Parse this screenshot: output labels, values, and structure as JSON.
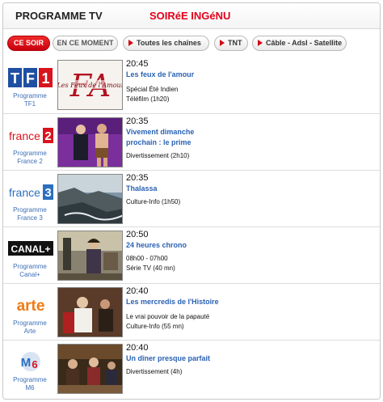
{
  "header": {
    "title": "PROGRAMME TV",
    "subtitle": "SOIRéE INGéNU"
  },
  "tabs": [
    {
      "label": "CE SOIR",
      "active": true
    },
    {
      "label": "EN CE MOMENT",
      "active": false
    },
    {
      "label": "Toutes les chaînes",
      "active": false
    },
    {
      "label": "TNT",
      "active": false
    },
    {
      "label": "Câble - Adsl - Satellite",
      "active": false
    }
  ],
  "programs": [
    {
      "channel_logo": "TF1",
      "channel_label": [
        "Programme",
        "TF1"
      ],
      "thumb_text": "Les Feux de l'Amour",
      "time": "20:45",
      "title": [
        "Les feux de l'amour"
      ],
      "desc": [
        "Spécial Été Indien",
        "Téléfilm (1h20)"
      ]
    },
    {
      "channel_logo": "france 2",
      "channel_label": [
        "Programme",
        "France 2"
      ],
      "time": "20:35",
      "title": [
        "Vivement dimanche",
        "prochain : le prime"
      ],
      "desc": [
        "Divertissement (2h10)"
      ]
    },
    {
      "channel_logo": "france 3",
      "channel_label": [
        "Programme",
        "France 3"
      ],
      "time": "20:35",
      "title": [
        "Thalassa"
      ],
      "desc": [
        "Culture-Info (1h50)"
      ]
    },
    {
      "channel_logo": "CANAL+",
      "channel_label": [
        "Programme",
        "Canal+"
      ],
      "time": "20:50",
      "title": [
        "24 heures chrono"
      ],
      "desc": [
        "08h00 - 07h00",
        "Série TV (40 mn)"
      ]
    },
    {
      "channel_logo": "arte",
      "channel_label": [
        "Programme",
        "Arte"
      ],
      "time": "20:40",
      "title": [
        "Les mercredis de l'Histoire"
      ],
      "desc": [
        "Le vrai pouvoir de la papauté",
        "Culture-Info (55 mn)"
      ]
    },
    {
      "channel_logo": "M6",
      "channel_label": [
        "Programme",
        "M6"
      ],
      "time": "20:40",
      "title": [
        "Un dîner presque parfait"
      ],
      "desc": [
        "Divertissement (4h)"
      ]
    }
  ],
  "colors": {
    "accent_red": "#e2001a",
    "link_blue": "#2a62b3",
    "label_blue": "#3d6fb5"
  }
}
